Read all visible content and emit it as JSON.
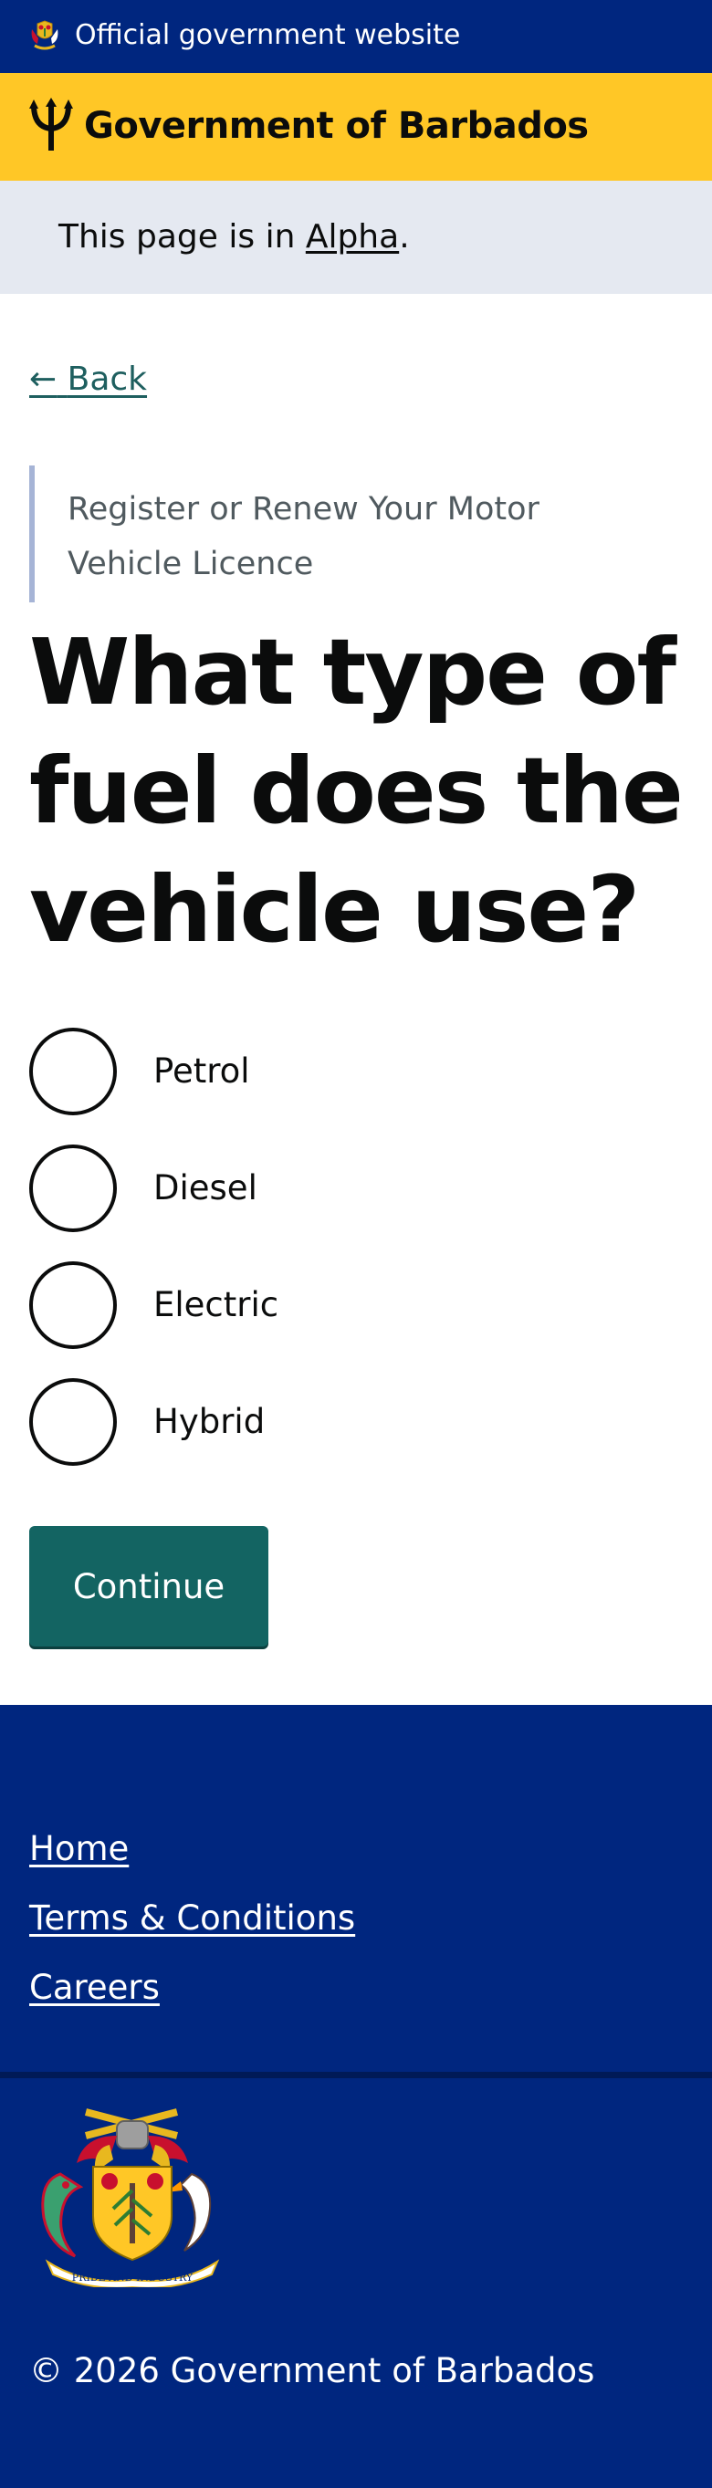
{
  "banner": {
    "official_text": "Official government website",
    "crest_icon": "barbados-coat-of-arms-icon"
  },
  "header": {
    "title": "Government of Barbados",
    "logo_icon": "trident-icon",
    "background_color": "#ffc726"
  },
  "phase_banner": {
    "prefix": "This page is in ",
    "phase": "Alpha",
    "suffix": "."
  },
  "back_link": {
    "arrow": "←",
    "label": "Back"
  },
  "service_caption": "Register or Renew Your Motor Vehicle Licence",
  "question": "What type of fuel does the vehicle use?",
  "fuel_options": [
    {
      "label": "Petrol",
      "selected": false
    },
    {
      "label": "Diesel",
      "selected": false
    },
    {
      "label": "Electric",
      "selected": false
    },
    {
      "label": "Hybrid",
      "selected": false
    }
  ],
  "continue_button": {
    "label": "Continue",
    "color": "#136462"
  },
  "footer": {
    "links": [
      {
        "label": "Home"
      },
      {
        "label": "Terms & Conditions"
      },
      {
        "label": "Careers"
      }
    ],
    "crest_icon": "barbados-coat-of-arms-icon",
    "crest_motto": "PRIDE AND INDUSTRY",
    "copyright": "© 2026 Government of Barbados",
    "background_color": "#00267f"
  }
}
